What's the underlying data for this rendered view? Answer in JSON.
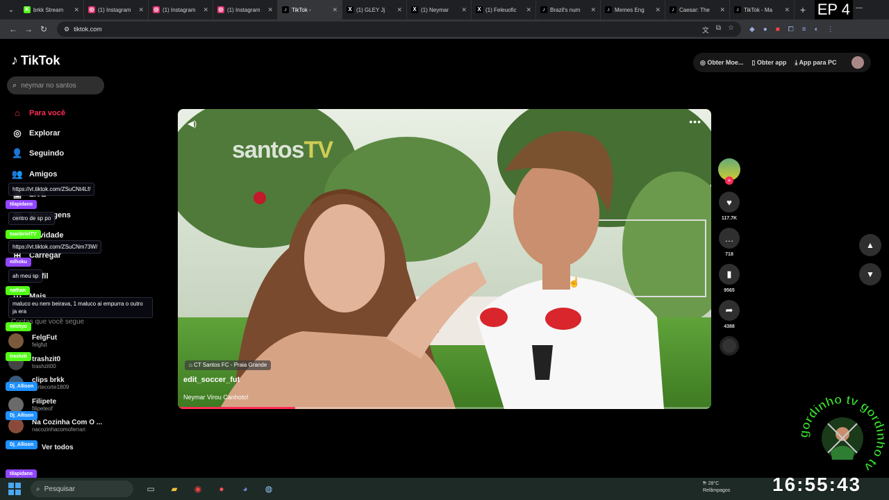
{
  "browser": {
    "tabs": [
      {
        "title": "brkk Stream",
        "fav": "K",
        "color": "#53fc18"
      },
      {
        "title": "(1) Instagram",
        "fav": "◎",
        "color": "#e1306c"
      },
      {
        "title": "(1) Instagram",
        "fav": "◎",
        "color": "#e1306c"
      },
      {
        "title": "(1) Instagram",
        "fav": "◎",
        "color": "#e1306c"
      },
      {
        "title": "TikTok -",
        "fav": "♪",
        "color": "#000000",
        "active": true
      },
      {
        "title": "(1) GLEY Jj",
        "fav": "X",
        "color": "#000000"
      },
      {
        "title": "(1) Neymar",
        "fav": "X",
        "color": "#000000"
      },
      {
        "title": "(1) Feleuofic",
        "fav": "X",
        "color": "#000000"
      },
      {
        "title": "Brazil's num",
        "fav": "♪",
        "color": "#000000"
      },
      {
        "title": "Memes Eng",
        "fav": "♪",
        "color": "#000000"
      },
      {
        "title": "Caesar: The",
        "fav": "♪",
        "color": "#000000"
      },
      {
        "title": "TikTok - Ma",
        "fav": "♪",
        "color": "#000000"
      }
    ],
    "url": "tiktok.com",
    "overlay_label": "EP 4"
  },
  "tiktok": {
    "logo_text": "TikTok",
    "search_placeholder": "neymar no santos",
    "nav": [
      {
        "label": "Para você",
        "icon": "⌂",
        "active": true
      },
      {
        "label": "Explorar",
        "icon": "◎"
      },
      {
        "label": "Seguindo",
        "icon": "👤"
      },
      {
        "label": "Amigos",
        "icon": "👥"
      },
      {
        "label": "LIVE",
        "icon": "▣"
      },
      {
        "label": "Mensagens",
        "icon": "✉"
      },
      {
        "label": "Atividade",
        "icon": "♡"
      },
      {
        "label": "Carregar",
        "icon": "⊞"
      },
      {
        "label": "Perfil",
        "icon": "○"
      },
      {
        "label": "Mais",
        "icon": "⋯"
      }
    ],
    "following_title": "Contas que você segue",
    "following": [
      {
        "name": "FelgFut",
        "user": "felgfut"
      },
      {
        "name": "trashzit0",
        "user": "trashzit00"
      },
      {
        "name": "clips brkk",
        "user": "cortecorte1809"
      },
      {
        "name": "Filipete",
        "user": "filipeteof"
      },
      {
        "name": "Na Cozinha Com O ...",
        "user": "nacozinhacomoferrari"
      }
    ],
    "see_all": "Ver todos",
    "top_actions": [
      "Obter Moe...",
      "Obter app",
      "App para PC"
    ],
    "video": {
      "watermark_a": "santos",
      "watermark_b": "TV",
      "location": "CT Santos FC - Praia Grande",
      "username": "edit_soccer_fut",
      "caption": "Neymar Virou Canhoto!",
      "progress": 0.22
    },
    "counts": {
      "likes": "117.7K",
      "comments": "718",
      "saves": "9565",
      "shares": "4388"
    }
  },
  "chat": [
    {
      "type": "msg",
      "text": "https://vt.tiktok.com/ZSuCNt4Lf/",
      "top": 0
    },
    {
      "type": "badge",
      "text": "tilapidano",
      "color": "#9146ff"
    },
    {
      "type": "msg",
      "text": "centro de sp po"
    },
    {
      "type": "badge",
      "text": "tuanbrielTV",
      "color": "#53fc18"
    },
    {
      "type": "msg",
      "text": "https://vt.tiktok.com/ZSuCNm73W/"
    },
    {
      "type": "badge",
      "text": "mlhoku",
      "color": "#9146ff"
    },
    {
      "type": "msg",
      "text": "ah meu sp"
    },
    {
      "type": "badge",
      "text": "nathan",
      "color": "#53fc18"
    },
    {
      "type": "msg",
      "text": "maluco eu nem beirava, 1 maluco ai empurra o outro ja era"
    },
    {
      "type": "badge",
      "text": "mlohyo",
      "color": "#53fc18"
    },
    {
      "type": "badge",
      "text": "trashzit",
      "color": "#53fc18"
    },
    {
      "type": "badge",
      "text": "Dj_Allison",
      "color": "#1e90ff"
    },
    {
      "type": "badge",
      "text": "Dj_Allison",
      "color": "#1e90ff"
    },
    {
      "type": "badge",
      "text": "Dj_Allison",
      "color": "#1e90ff"
    },
    {
      "type": "badge",
      "text": "tilapidano",
      "color": "#9146ff"
    }
  ],
  "taskbar": {
    "search": "Pesquisar",
    "weather_temp": "28°C",
    "weather_desc": "Relâmpagos",
    "clock": "16:55:43"
  },
  "brand": {
    "text": "gordinho tv"
  }
}
